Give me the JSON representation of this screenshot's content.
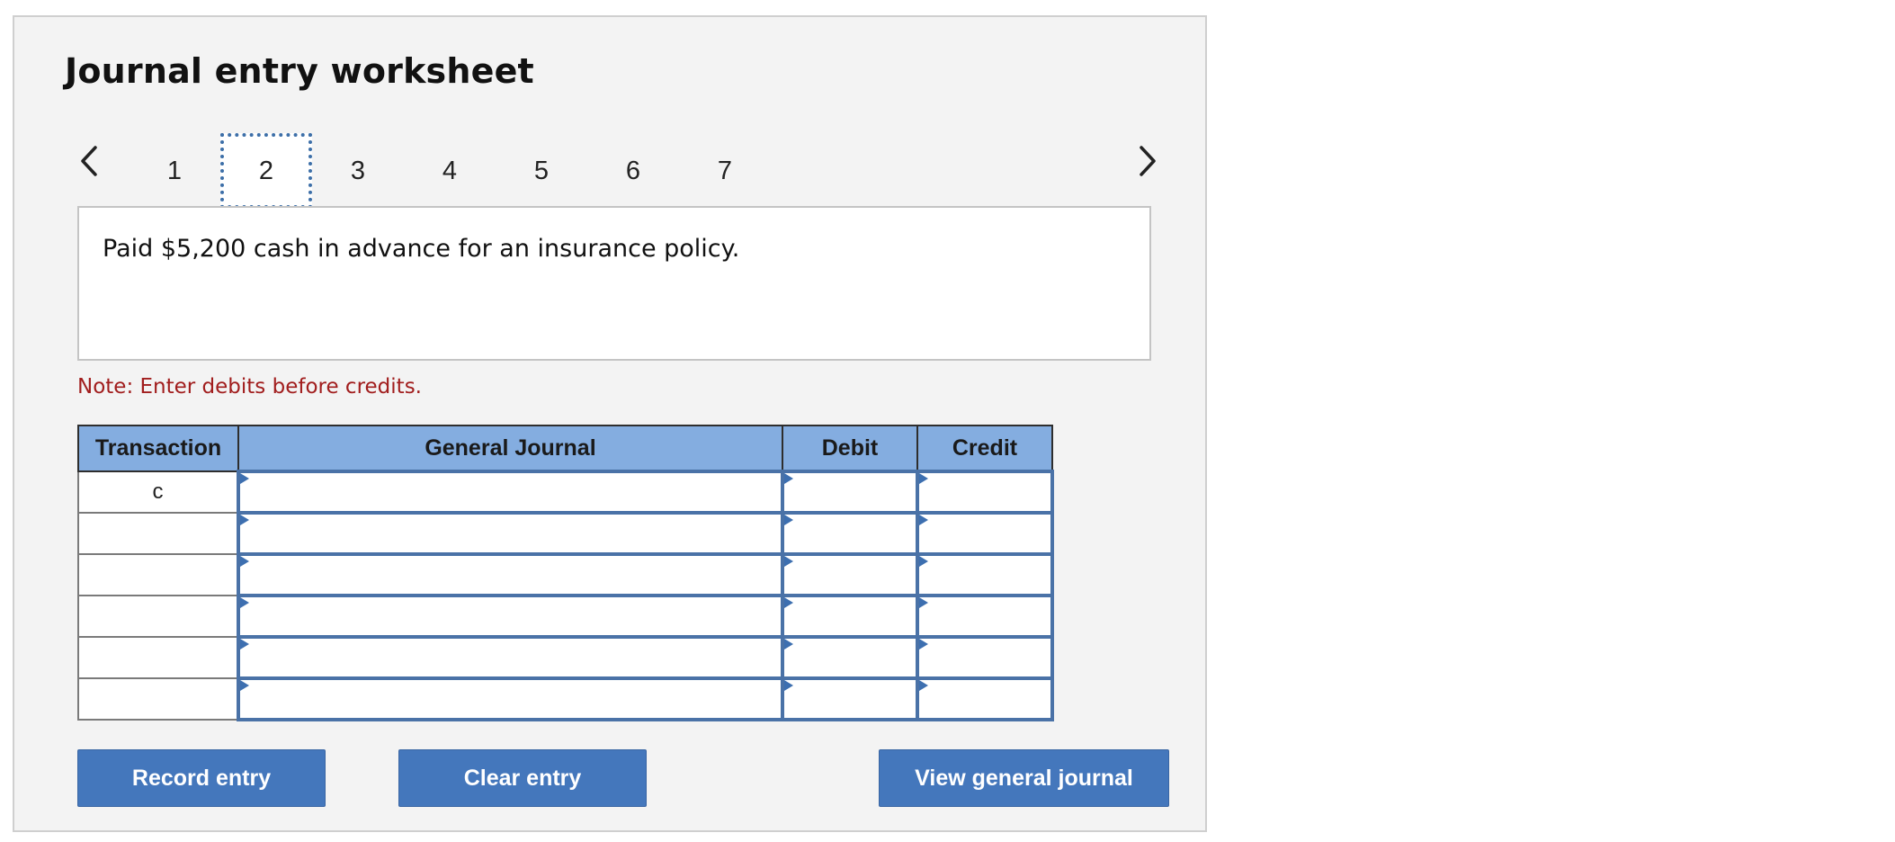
{
  "worksheet": {
    "title": "Journal entry worksheet",
    "tabs": [
      "1",
      "2",
      "3",
      "4",
      "5",
      "6",
      "7"
    ],
    "active_tab": "2",
    "description": "Paid $5,200 cash in advance for an insurance policy.",
    "note": "Note: Enter debits before credits."
  },
  "table": {
    "headers": {
      "transaction": "Transaction",
      "general_journal": "General Journal",
      "debit": "Debit",
      "credit": "Credit"
    },
    "rows": [
      {
        "transaction": "c",
        "account": "",
        "debit": "",
        "credit": ""
      },
      {
        "transaction": "",
        "account": "",
        "debit": "",
        "credit": ""
      },
      {
        "transaction": "",
        "account": "",
        "debit": "",
        "credit": ""
      },
      {
        "transaction": "",
        "account": "",
        "debit": "",
        "credit": ""
      },
      {
        "transaction": "",
        "account": "",
        "debit": "",
        "credit": ""
      },
      {
        "transaction": "",
        "account": "",
        "debit": "",
        "credit": ""
      }
    ]
  },
  "buttons": {
    "record": "Record entry",
    "clear": "Clear entry",
    "view": "View general journal"
  },
  "icons": {
    "prev": "chevron-left-icon",
    "next": "chevron-right-icon"
  },
  "colors": {
    "header_bg": "#84ade0",
    "button_bg": "#4477bc",
    "note_text": "#a11d1d",
    "active_tab_border": "#3d6fa8"
  }
}
